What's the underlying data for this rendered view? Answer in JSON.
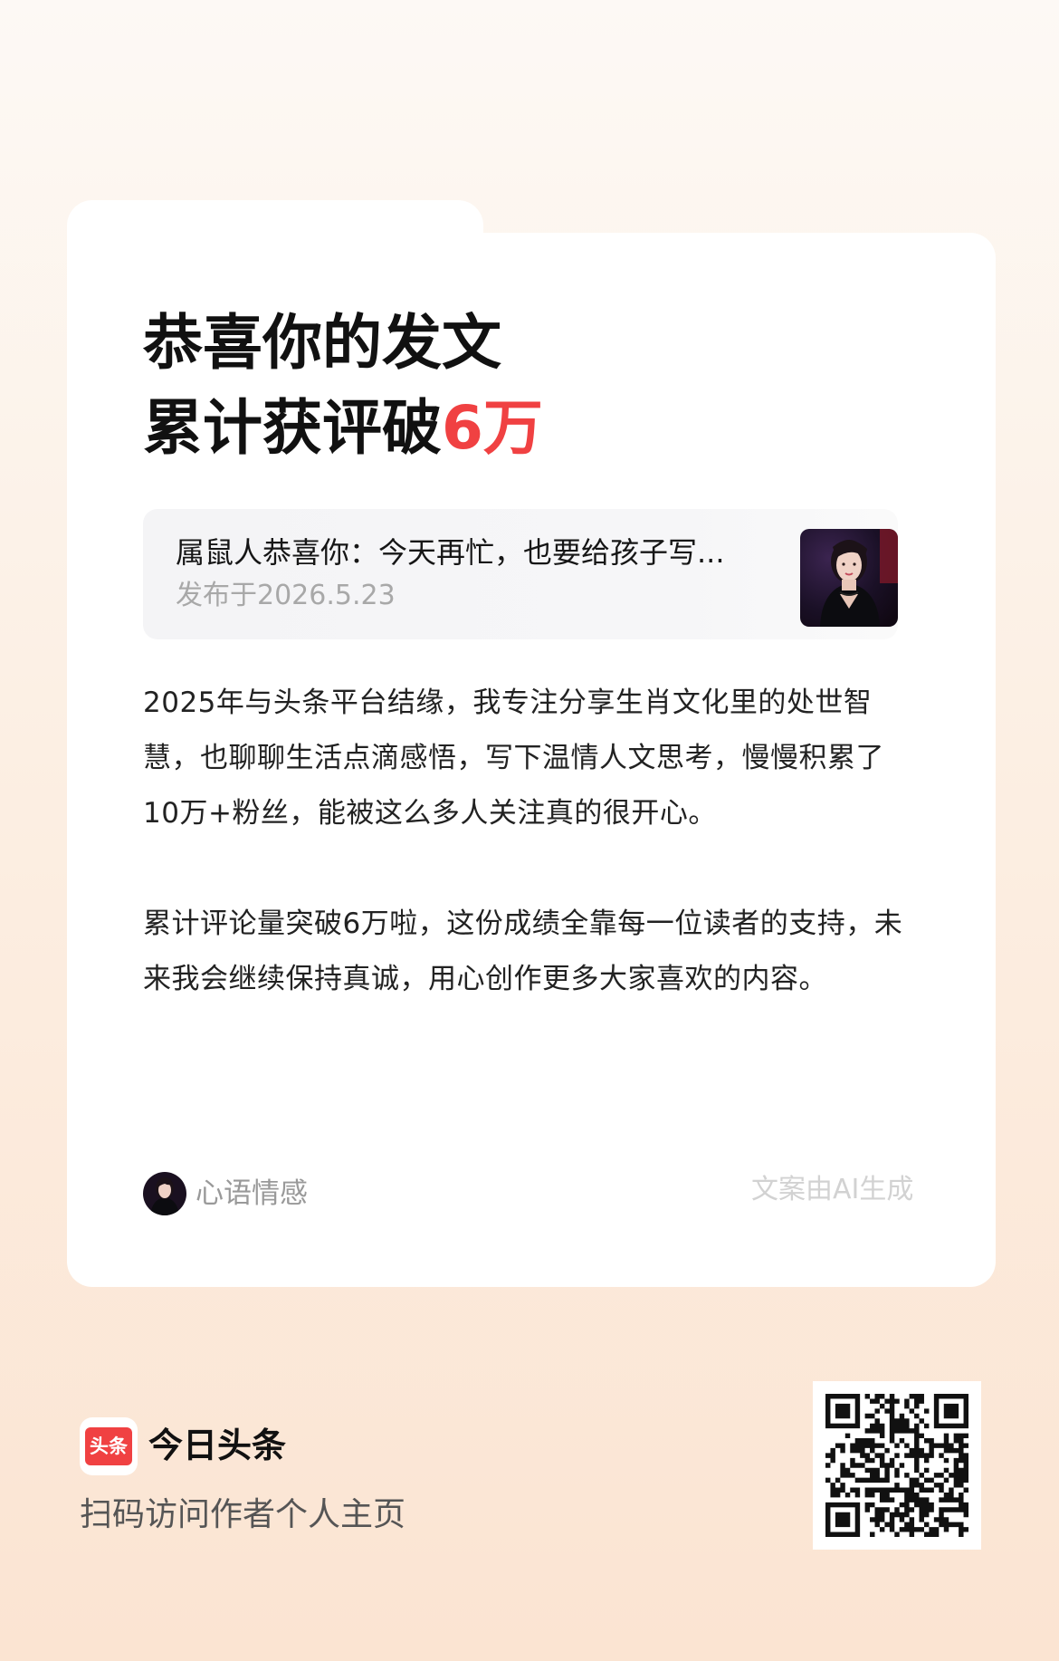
{
  "headline": {
    "line1": "恭喜你的发文",
    "line2_prefix": "累计获评破",
    "line2_highlight": "6万"
  },
  "article": {
    "title": "属鼠人恭喜你：今天再忙，也要给孩子写...",
    "date": "发布于2026.5.23"
  },
  "body": {
    "paragraph1": "2025年与头条平台结缘，我专注分享生肖文化里的处世智慧，也聊聊生活点滴感悟，写下温情人文思考，慢慢积累了10万+粉丝，能被这么多人关注真的很开心。",
    "paragraph2": "累计评论量突破6万啦，这份成绩全靠每一位读者的支持，未来我会继续保持真诚，用心创作更多大家喜欢的内容。"
  },
  "author": {
    "name": "心语情感"
  },
  "ai_note": "文案由AI生成",
  "footer": {
    "logo_text": "头条",
    "brand": "今日头条",
    "scan_text": "扫码访问作者个人主页"
  },
  "colors": {
    "accent": "#f04142",
    "background_top": "#fdf9f5",
    "background_bottom": "#fbe4d2"
  }
}
